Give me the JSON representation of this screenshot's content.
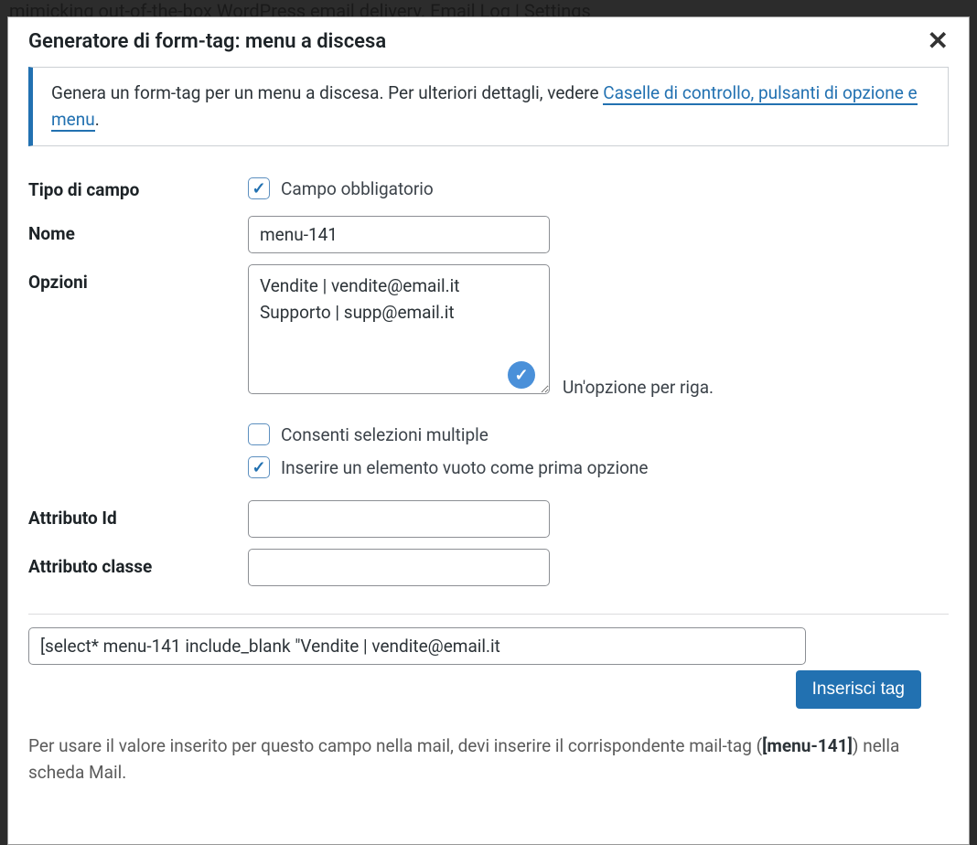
{
  "background": "mimicking out-of-the-box WordPress email delivery. Email Log | Settings",
  "modal": {
    "title": "Generatore di form-tag: menu a discesa",
    "info_text_before": "Genera un form-tag per un menu a discesa. Per ulteriori dettagli, vedere ",
    "info_link": "Caselle di controllo, pulsanti di opzione e menu",
    "info_text_after": "."
  },
  "fields": {
    "type_label": "Tipo di campo",
    "required_label": "Campo obbligatorio",
    "required_checked": true,
    "name_label": "Nome",
    "name_value": "menu-141",
    "options_label": "Opzioni",
    "options_value": "Vendite | vendite@email.it\nSupporto | supp@email.it",
    "options_hint": "Un'opzione per riga.",
    "multiple_label": "Consenti selezioni multiple",
    "multiple_checked": false,
    "blank_label": "Inserire un elemento vuoto come prima opzione",
    "blank_checked": true,
    "id_label": "Attributo Id",
    "id_value": "",
    "class_label": "Attributo classe",
    "class_value": ""
  },
  "shortcode": "[select* menu-141 include_blank \"Vendite | vendite@email.it",
  "insert_button": "Inserisci tag",
  "footer": {
    "before": "Per usare il valore inserito per questo campo nella mail, devi inserire il corrispondente mail-tag (",
    "tag": "[menu-141]",
    "after": ") nella scheda Mail."
  }
}
